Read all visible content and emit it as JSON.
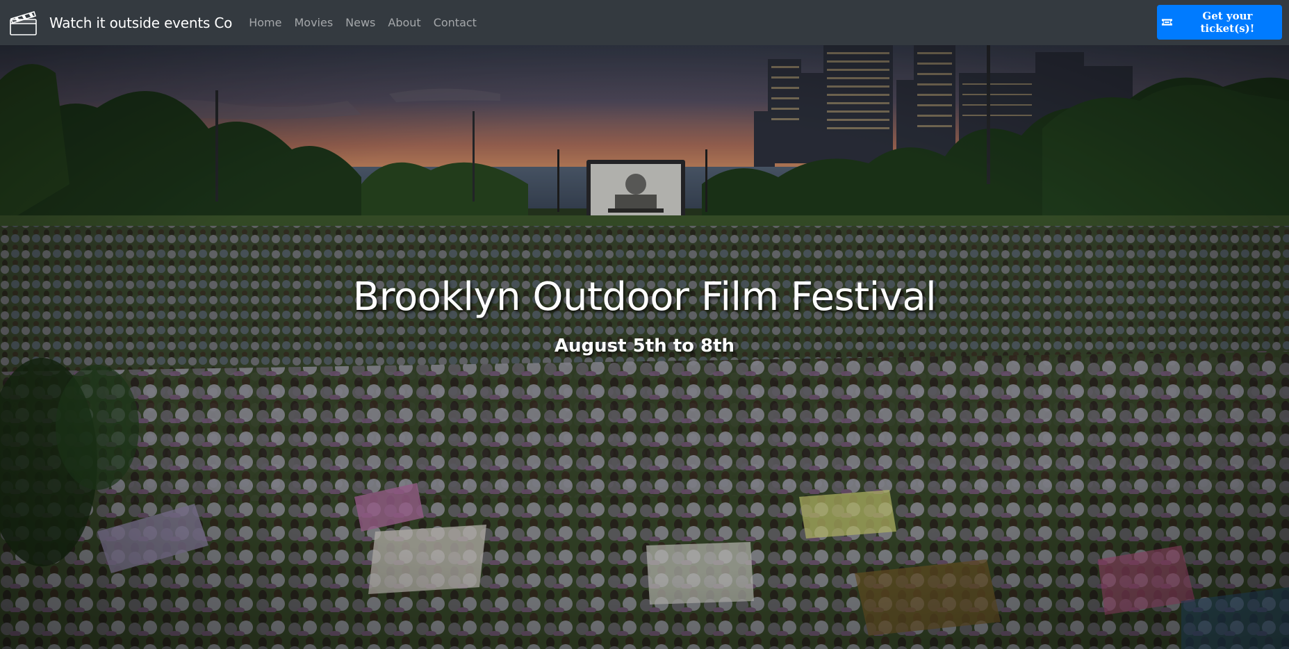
{
  "navbar": {
    "brand_icon": "clapperboard-icon",
    "brand": "Watch it outside events Co",
    "links": [
      {
        "label": "Home"
      },
      {
        "label": "Movies"
      },
      {
        "label": "News"
      },
      {
        "label": "About"
      },
      {
        "label": "Contact"
      }
    ],
    "cta_icon": "ticket-icon",
    "cta_label": "Get your ticket(s)!"
  },
  "hero": {
    "title": "Brooklyn Outdoor Film Festival",
    "subtitle": "August 5th to 8th"
  },
  "colors": {
    "navbar_bg": "#343a40",
    "accent": "#007bff",
    "nav_link": "rgba(255,255,255,0.55)"
  }
}
